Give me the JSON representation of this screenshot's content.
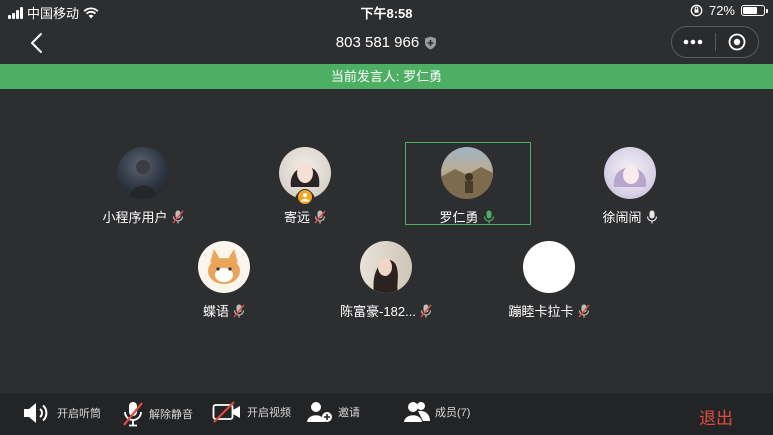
{
  "status_bar": {
    "carrier": "中国移动",
    "time": "下午8:58",
    "battery_percent": "72%",
    "battery_level": 0.72
  },
  "nav": {
    "meeting_id": "803 581 966"
  },
  "banner": {
    "label": "当前发言人: 罗仁勇"
  },
  "participants": [
    {
      "name": "小程序用户",
      "mic": "muted"
    },
    {
      "name": "寄远",
      "mic": "muted",
      "host": true
    },
    {
      "name": "罗仁勇",
      "mic": "speaking"
    },
    {
      "name": "徐闹闹",
      "mic": "on"
    },
    {
      "name": "蝶语",
      "mic": "muted"
    },
    {
      "name": "陈富豪-182...",
      "mic": "muted"
    },
    {
      "name": "蹦睦卡拉卡",
      "mic": "muted"
    }
  ],
  "toolbar": {
    "speaker_label": "开启听筒",
    "unmute_label": "解除静音",
    "video_label": "开启视频",
    "invite_label": "邀请",
    "members_label": "成员(7)",
    "exit_label": "退出"
  },
  "colors": {
    "accent_green": "#4caf63",
    "exit_red": "#e04a3f",
    "host_badge": "#f5a623"
  }
}
